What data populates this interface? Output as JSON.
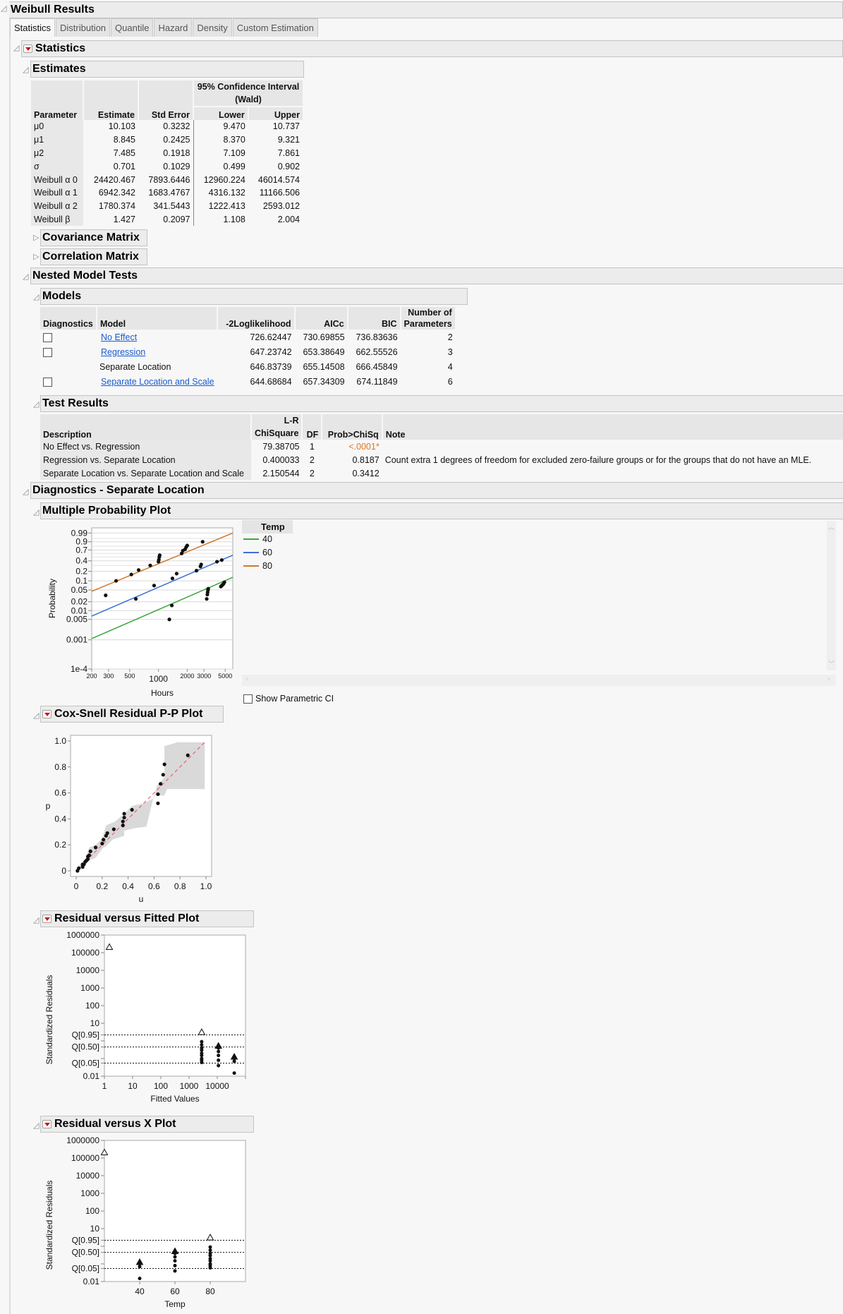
{
  "window": {
    "title": "Weibull Results"
  },
  "tabs": [
    {
      "label": "Statistics",
      "active": true
    },
    {
      "label": "Distribution",
      "active": false
    },
    {
      "label": "Quantile",
      "active": false
    },
    {
      "label": "Hazard",
      "active": false
    },
    {
      "label": "Density",
      "active": false
    },
    {
      "label": "Custom Estimation",
      "active": false
    }
  ],
  "sections": {
    "statistics": "Statistics",
    "estimates": "Estimates",
    "covariance": "Covariance Matrix",
    "correlation": "Correlation Matrix",
    "nested": "Nested Model Tests",
    "models": "Models",
    "test_results": "Test Results",
    "diagnostics": "Diagnostics - Separate Location",
    "multiple_prob": "Multiple Probability Plot",
    "cox_snell": "Cox-Snell Residual P-P Plot",
    "resid_fitted": "Residual versus Fitted Plot",
    "resid_x": "Residual versus X Plot"
  },
  "estimates": {
    "ci_header": "95% Confidence Interval (Wald)",
    "columns": [
      "Parameter",
      "Estimate",
      "Std Error",
      "Lower",
      "Upper"
    ],
    "rows": [
      [
        "μ0",
        "10.103",
        "0.3232",
        "9.470",
        "10.737"
      ],
      [
        "μ1",
        "8.845",
        "0.2425",
        "8.370",
        "9.321"
      ],
      [
        "μ2",
        "7.485",
        "0.1918",
        "7.109",
        "7.861"
      ],
      [
        "σ",
        "0.701",
        "0.1029",
        "0.499",
        "0.902"
      ],
      [
        "Weibull α 0",
        "24420.467",
        "7893.6446",
        "12960.224",
        "46014.574"
      ],
      [
        "Weibull α 1",
        "6942.342",
        "1683.4767",
        "4316.132",
        "11166.506"
      ],
      [
        "Weibull α 2",
        "1780.374",
        "341.5443",
        "1222.413",
        "2593.012"
      ],
      [
        "Weibull β",
        "1.427",
        "0.2097",
        "1.108",
        "2.004"
      ]
    ]
  },
  "models": {
    "columns": [
      "Diagnostics",
      "Model",
      "-2Loglikelihood",
      "AICc",
      "BIC",
      "Number of Parameters"
    ],
    "rows": [
      {
        "checkbox": true,
        "model": "No Effect",
        "link": true,
        "ll": "726.62447",
        "aicc": "730.69855",
        "bic": "736.83636",
        "n": "2"
      },
      {
        "checkbox": true,
        "model": "Regression",
        "link": true,
        "ll": "647.23742",
        "aicc": "653.38649",
        "bic": "662.55526",
        "n": "3"
      },
      {
        "checkbox": false,
        "model": "Separate Location",
        "link": false,
        "ll": "646.83739",
        "aicc": "655.14508",
        "bic": "666.45849",
        "n": "4"
      },
      {
        "checkbox": true,
        "model": "Separate Location and Scale",
        "link": true,
        "ll": "644.68684",
        "aicc": "657.34309",
        "bic": "674.11849",
        "n": "6"
      }
    ]
  },
  "test_results": {
    "columns": [
      "Description",
      "L-R ChiSquare",
      "DF",
      "Prob>ChiSq",
      "Note"
    ],
    "rows": [
      {
        "desc": "No Effect vs. Regression",
        "chisq": "79.38705",
        "df": "1",
        "prob": "<.0001*",
        "sig": true,
        "note": ""
      },
      {
        "desc": "Regression vs. Separate Location",
        "chisq": "0.400033",
        "df": "2",
        "prob": "0.8187",
        "sig": false,
        "note": "Count extra 1 degrees of freedom for excluded zero-failure groups or for the groups that do not have an MLE."
      },
      {
        "desc": "Separate Location vs. Separate Location and Scale",
        "chisq": "2.150544",
        "df": "2",
        "prob": "0.3412",
        "sig": false,
        "note": ""
      }
    ]
  },
  "show_parametric_ci": {
    "label": "Show Parametric CI",
    "checked": false
  },
  "colors": {
    "40": "#3aa63a",
    "60": "#3b6fd6",
    "80": "#d0782a",
    "sig": "#e0761a",
    "link": "#1a5ccf"
  },
  "chart_data": [
    {
      "type": "scatter",
      "title": "Multiple Probability Plot",
      "xlabel": "Hours",
      "ylabel": "Probability",
      "xscale": "log",
      "xlim": [
        200,
        6000
      ],
      "yscale": "weibull",
      "ylim": [
        0.0001,
        0.999
      ],
      "xticks": [
        "200",
        "300",
        "500",
        "1000",
        "2000",
        "3000",
        "5000"
      ],
      "yticks": [
        "1e-4",
        "0.001",
        "0.005",
        "0.01",
        "0.02",
        "0.05",
        "0.1",
        "0.2",
        "0.4",
        "0.7",
        "0.9",
        "0.99"
      ],
      "legend_title": "Temp",
      "series": [
        {
          "name": "40",
          "line": [
            [
              200,
              0.0011
            ],
            [
              6000,
              0.13
            ]
          ],
          "points": [
            [
              1300,
              0.005
            ],
            [
              1380,
              0.015
            ],
            [
              3200,
              0.025
            ],
            [
              3250,
              0.035
            ],
            [
              3270,
              0.042
            ],
            [
              3300,
              0.05
            ],
            [
              3320,
              0.055
            ],
            [
              4500,
              0.065
            ],
            [
              4600,
              0.07
            ],
            [
              4700,
              0.075
            ],
            [
              4800,
              0.08
            ],
            [
              4900,
              0.09
            ]
          ]
        },
        {
          "name": "60",
          "line": [
            [
              200,
              0.0065
            ],
            [
              6000,
              0.55
            ]
          ],
          "points": [
            [
              280,
              0.033
            ],
            [
              580,
              0.025
            ],
            [
              900,
              0.07
            ],
            [
              1400,
              0.12
            ],
            [
              1550,
              0.17
            ],
            [
              2500,
              0.21
            ],
            [
              2750,
              0.28
            ],
            [
              2800,
              0.32
            ],
            [
              4100,
              0.38
            ],
            [
              4600,
              0.42
            ]
          ]
        },
        {
          "name": "80",
          "line": [
            [
              200,
              0.045
            ],
            [
              6000,
              0.99
            ]
          ],
          "points": [
            [
              360,
              0.1
            ],
            [
              520,
              0.16
            ],
            [
              620,
              0.22
            ],
            [
              820,
              0.3
            ],
            [
              1000,
              0.38
            ],
            [
              1010,
              0.43
            ],
            [
              1020,
              0.5
            ],
            [
              1030,
              0.55
            ],
            [
              1750,
              0.6
            ],
            [
              1800,
              0.68
            ],
            [
              1900,
              0.72
            ],
            [
              1950,
              0.78
            ],
            [
              2000,
              0.82
            ],
            [
              2900,
              0.9
            ]
          ]
        }
      ]
    },
    {
      "type": "scatter",
      "title": "Cox-Snell Residual P-P Plot",
      "xlabel": "u",
      "ylabel": "p",
      "xlim": [
        0,
        1
      ],
      "ylim": [
        0,
        1
      ],
      "xticks": [
        "0",
        "0.2",
        "0.4",
        "0.6",
        "0.8",
        "1.0"
      ],
      "yticks": [
        "0",
        "0.2",
        "0.4",
        "0.6",
        "0.8",
        "1.0"
      ],
      "points": [
        [
          0.01,
          0.0
        ],
        [
          0.02,
          0.02
        ],
        [
          0.05,
          0.03
        ],
        [
          0.05,
          0.05
        ],
        [
          0.06,
          0.05
        ],
        [
          0.07,
          0.07
        ],
        [
          0.08,
          0.08
        ],
        [
          0.09,
          0.09
        ],
        [
          0.09,
          0.11
        ],
        [
          0.1,
          0.12
        ],
        [
          0.11,
          0.15
        ],
        [
          0.15,
          0.18
        ],
        [
          0.2,
          0.21
        ],
        [
          0.21,
          0.24
        ],
        [
          0.23,
          0.27
        ],
        [
          0.24,
          0.29
        ],
        [
          0.29,
          0.32
        ],
        [
          0.36,
          0.35
        ],
        [
          0.36,
          0.38
        ],
        [
          0.37,
          0.41
        ],
        [
          0.37,
          0.44
        ],
        [
          0.43,
          0.47
        ],
        [
          0.63,
          0.52
        ],
        [
          0.63,
          0.59
        ],
        [
          0.65,
          0.67
        ],
        [
          0.67,
          0.74
        ],
        [
          0.68,
          0.82
        ],
        [
          0.86,
          0.89
        ]
      ],
      "band": "simultaneous confidence band (grey)",
      "reference_line": "y = x (red dashed)"
    },
    {
      "type": "scatter",
      "title": "Residual versus Fitted Plot",
      "xlabel": "Fitted Values",
      "ylabel": "Standardized Residuals",
      "xscale": "log",
      "xlim": [
        1,
        100000
      ],
      "yscale": "log",
      "ylim": [
        0.01,
        1000000
      ],
      "xticks": [
        "1",
        "10",
        "100",
        "1000",
        "10000"
      ],
      "yticks": [
        "0.01",
        "Q[0.05]",
        "Q[0.50]",
        "Q[0.95]",
        "10",
        "100",
        "1000",
        "10000",
        "100000",
        "1000000"
      ],
      "reference_lines": [
        "Q[0.95]",
        "Q[0.50]",
        "Q[0.05]"
      ],
      "points": [
        [
          2800,
          0.9
        ],
        [
          2800,
          0.6
        ],
        [
          2800,
          0.4
        ],
        [
          2800,
          0.3
        ],
        [
          2800,
          0.2
        ],
        [
          2800,
          0.15
        ],
        [
          2800,
          0.1
        ],
        [
          2800,
          0.08
        ],
        [
          2800,
          0.06
        ],
        [
          11000,
          0.4
        ],
        [
          11000,
          0.25
        ],
        [
          11000,
          0.15
        ],
        [
          11000,
          0.08
        ],
        [
          11000,
          0.04
        ],
        [
          40000,
          0.1
        ],
        [
          40000,
          0.07
        ],
        [
          40000,
          0.015
        ]
      ],
      "censored": [
        [
          1.5,
          200000
        ],
        [
          2800,
          3.0
        ],
        [
          11000,
          0.5
        ],
        [
          40000,
          0.12
        ]
      ]
    },
    {
      "type": "scatter",
      "title": "Residual versus X Plot",
      "xlabel": "Temp",
      "ylabel": "Standardized Residuals",
      "xlim": [
        20,
        100
      ],
      "yscale": "log",
      "ylim": [
        0.01,
        1000000
      ],
      "xticks": [
        "40",
        "60",
        "80"
      ],
      "yticks": [
        "0.01",
        "Q[0.05]",
        "Q[0.50]",
        "Q[0.95]",
        "10",
        "100",
        "1000",
        "10000",
        "100000",
        "1000000"
      ],
      "reference_lines": [
        "Q[0.95]",
        "Q[0.50]",
        "Q[0.05]"
      ],
      "points": [
        [
          40,
          0.1
        ],
        [
          40,
          0.07
        ],
        [
          40,
          0.015
        ],
        [
          60,
          0.4
        ],
        [
          60,
          0.25
        ],
        [
          60,
          0.15
        ],
        [
          60,
          0.08
        ],
        [
          60,
          0.04
        ],
        [
          80,
          0.9
        ],
        [
          80,
          0.6
        ],
        [
          80,
          0.4
        ],
        [
          80,
          0.3
        ],
        [
          80,
          0.2
        ],
        [
          80,
          0.15
        ],
        [
          80,
          0.1
        ],
        [
          80,
          0.08
        ],
        [
          80,
          0.06
        ]
      ],
      "censored": [
        [
          20,
          200000
        ],
        [
          40,
          0.12
        ],
        [
          60,
          0.5
        ],
        [
          80,
          3.0
        ]
      ]
    }
  ]
}
